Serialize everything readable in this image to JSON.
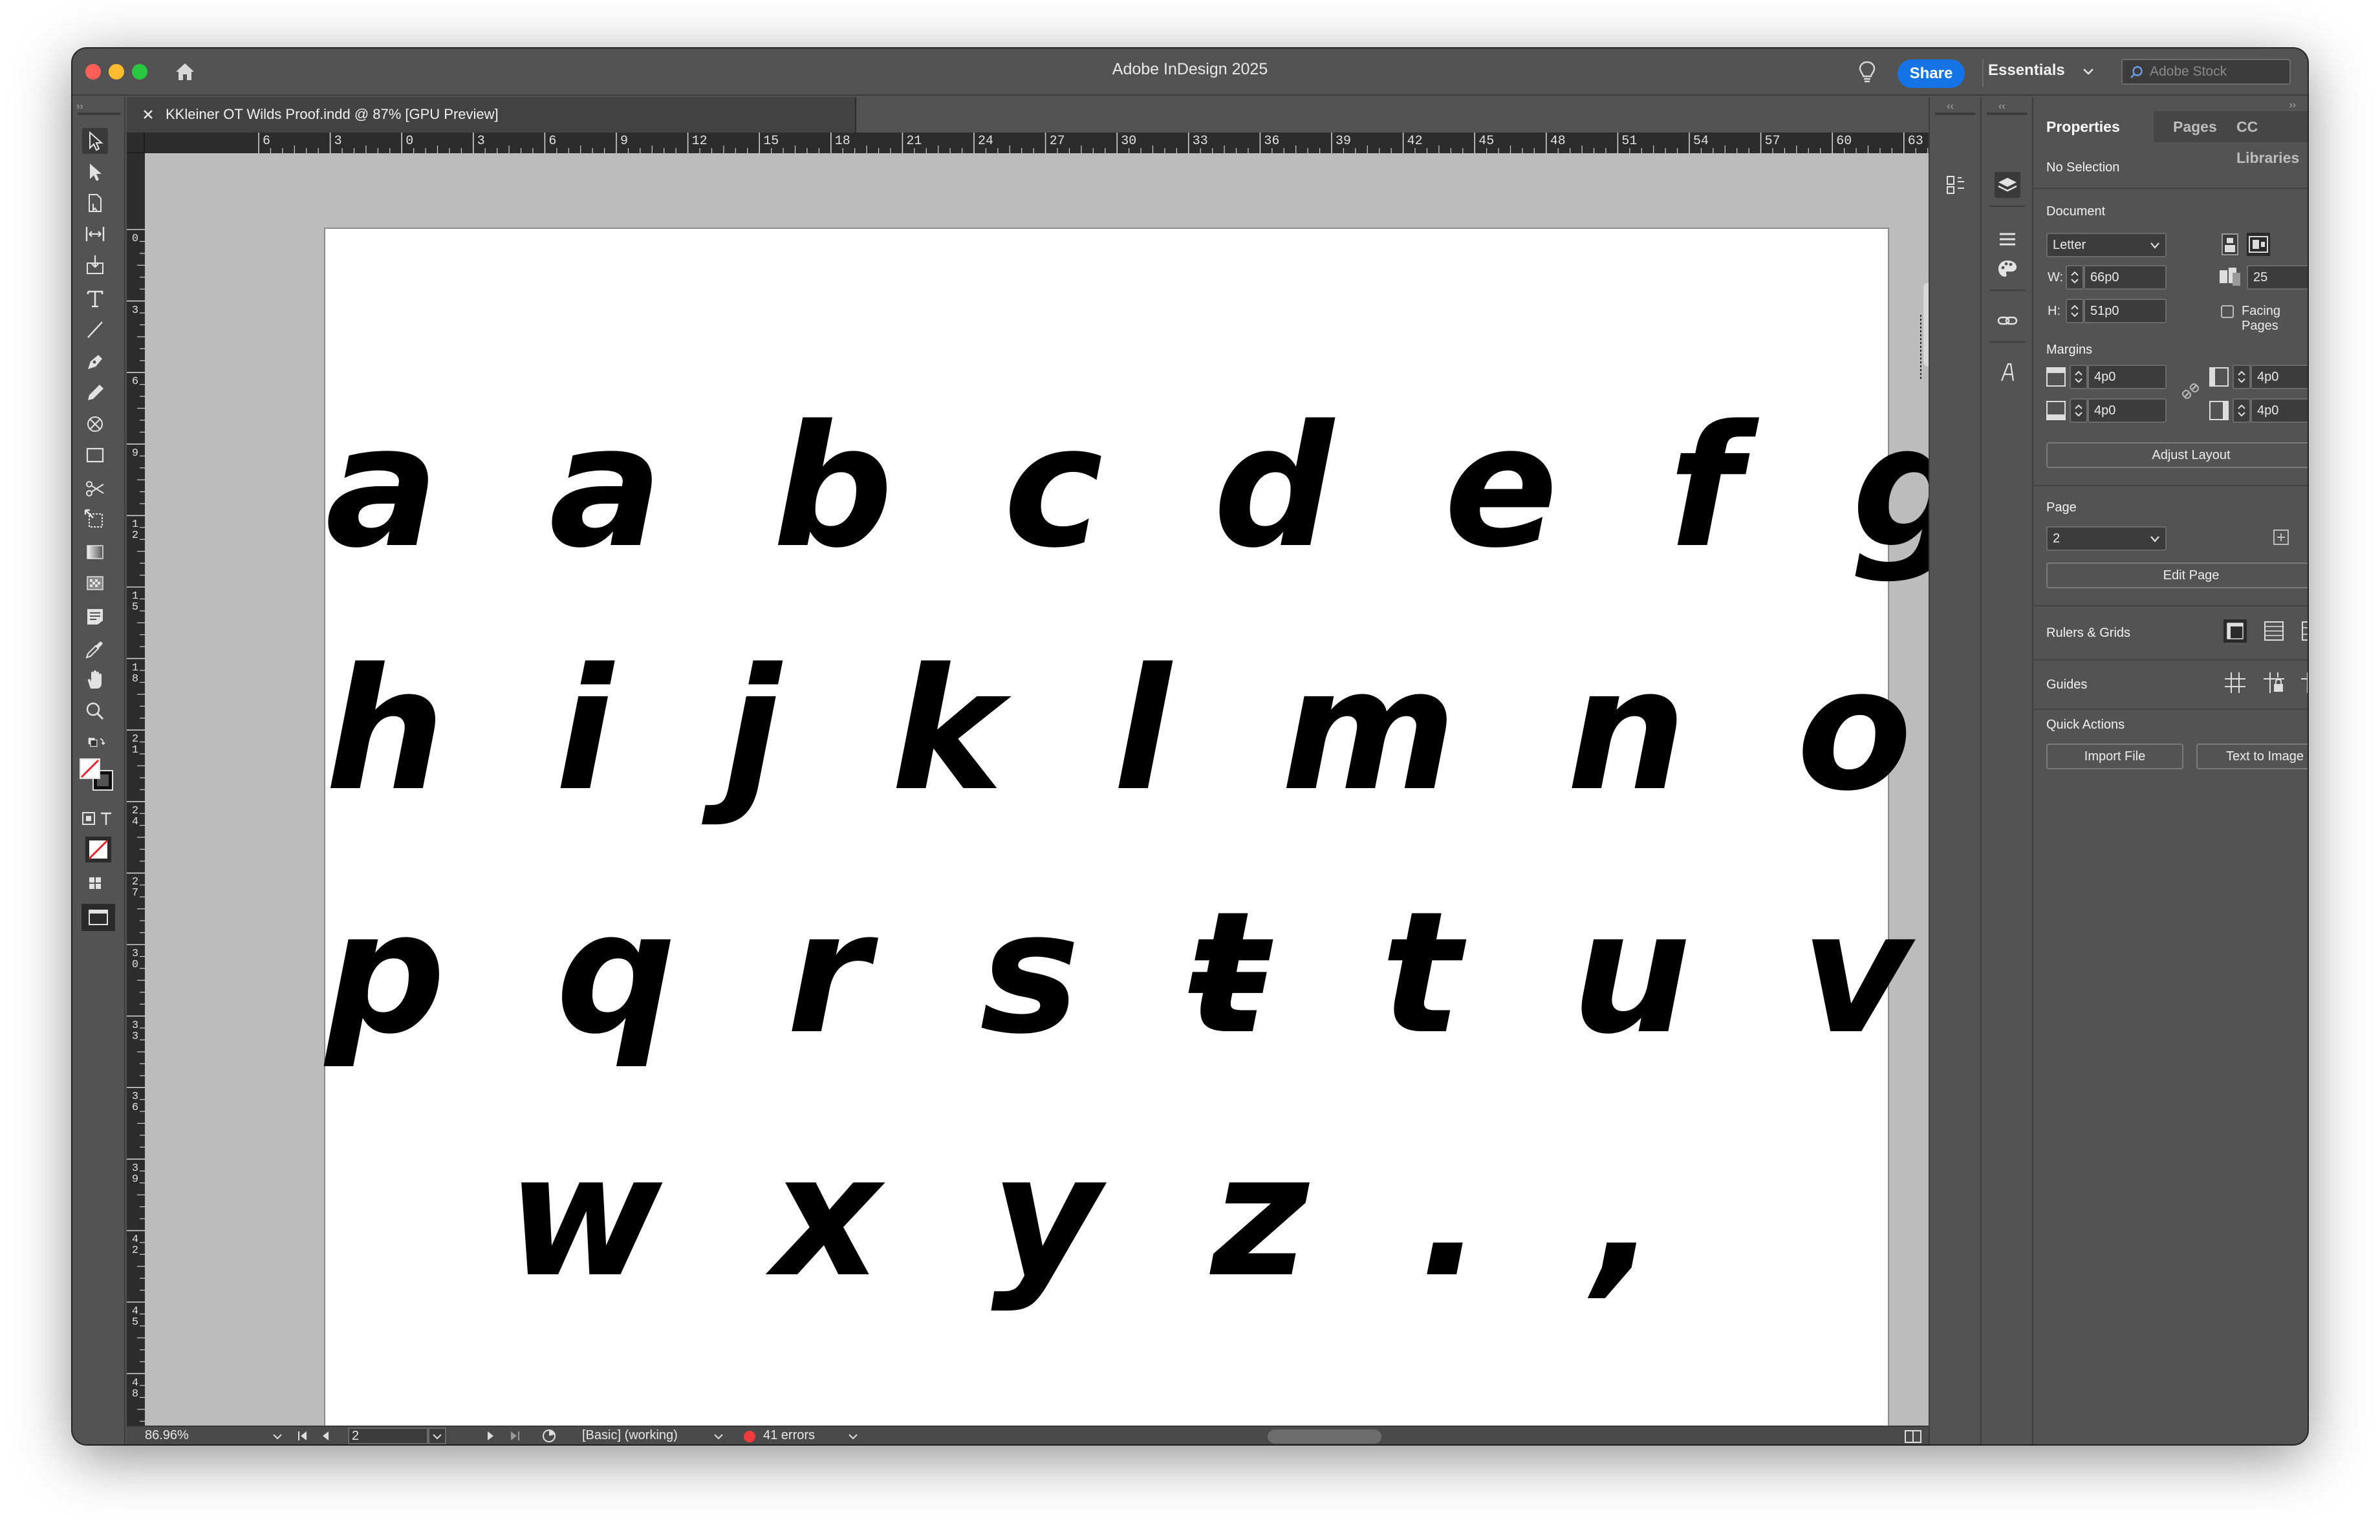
{
  "app": {
    "title": "Adobe InDesign 2025",
    "share_label": "Share",
    "workspace": "Essentials",
    "stock_placeholder": "Adobe Stock"
  },
  "document": {
    "tab_title": "KKleiner OT Wilds Proof.indd @ 87% [GPU Preview]"
  },
  "rulers": {
    "horizontal": [
      "6",
      "3",
      "0",
      "3",
      "6",
      "9",
      "12",
      "15",
      "18",
      "21",
      "24",
      "27",
      "30",
      "33",
      "36",
      "39",
      "42",
      "45",
      "48",
      "51",
      "54",
      "57",
      "60",
      "63"
    ],
    "vertical": [
      "0",
      "3",
      "6",
      "9",
      "1\n2",
      "1\n5",
      "1\n8",
      "2\n1",
      "2\n4",
      "2\n7",
      "3\n0",
      "3\n3",
      "3\n6",
      "3\n9",
      "4\n2",
      "4\n5",
      "4\n8",
      "5\n1"
    ]
  },
  "page_content": {
    "lines": [
      "a a b c d e f g",
      "h i j k l m n o",
      "p q r s ŧ t u v",
      "w x y z . ,"
    ]
  },
  "status_bar": {
    "zoom": "86.96%",
    "page": "2",
    "profile": "[Basic] (working)",
    "errors": "41 errors",
    "error_color": "#ee3b3b"
  },
  "properties": {
    "tabs": [
      "Properties",
      "Pages",
      "CC Libraries"
    ],
    "selection": "No Selection",
    "document_title": "Document",
    "preset": "Letter",
    "w_label": "W:",
    "width": "66p0",
    "h_label": "H:",
    "height": "51p0",
    "pages_count": "25",
    "facing_pages": "Facing Pages",
    "margins_title": "Margins",
    "margin_top": "4p0",
    "margin_bottom": "4p0",
    "margin_left": "4p0",
    "margin_right": "4p0",
    "adjust_layout": "Adjust Layout",
    "page_title": "Page",
    "page_value": "2",
    "edit_page": "Edit Page",
    "rulers_grids": "Rulers & Grids",
    "guides": "Guides",
    "quick_actions": "Quick Actions",
    "import_file": "Import File",
    "text_to_image": "Text to Image"
  },
  "colors": {
    "accent": "#1473e6",
    "chrome": "#535353",
    "pasteboard": "#bcbcbc"
  }
}
